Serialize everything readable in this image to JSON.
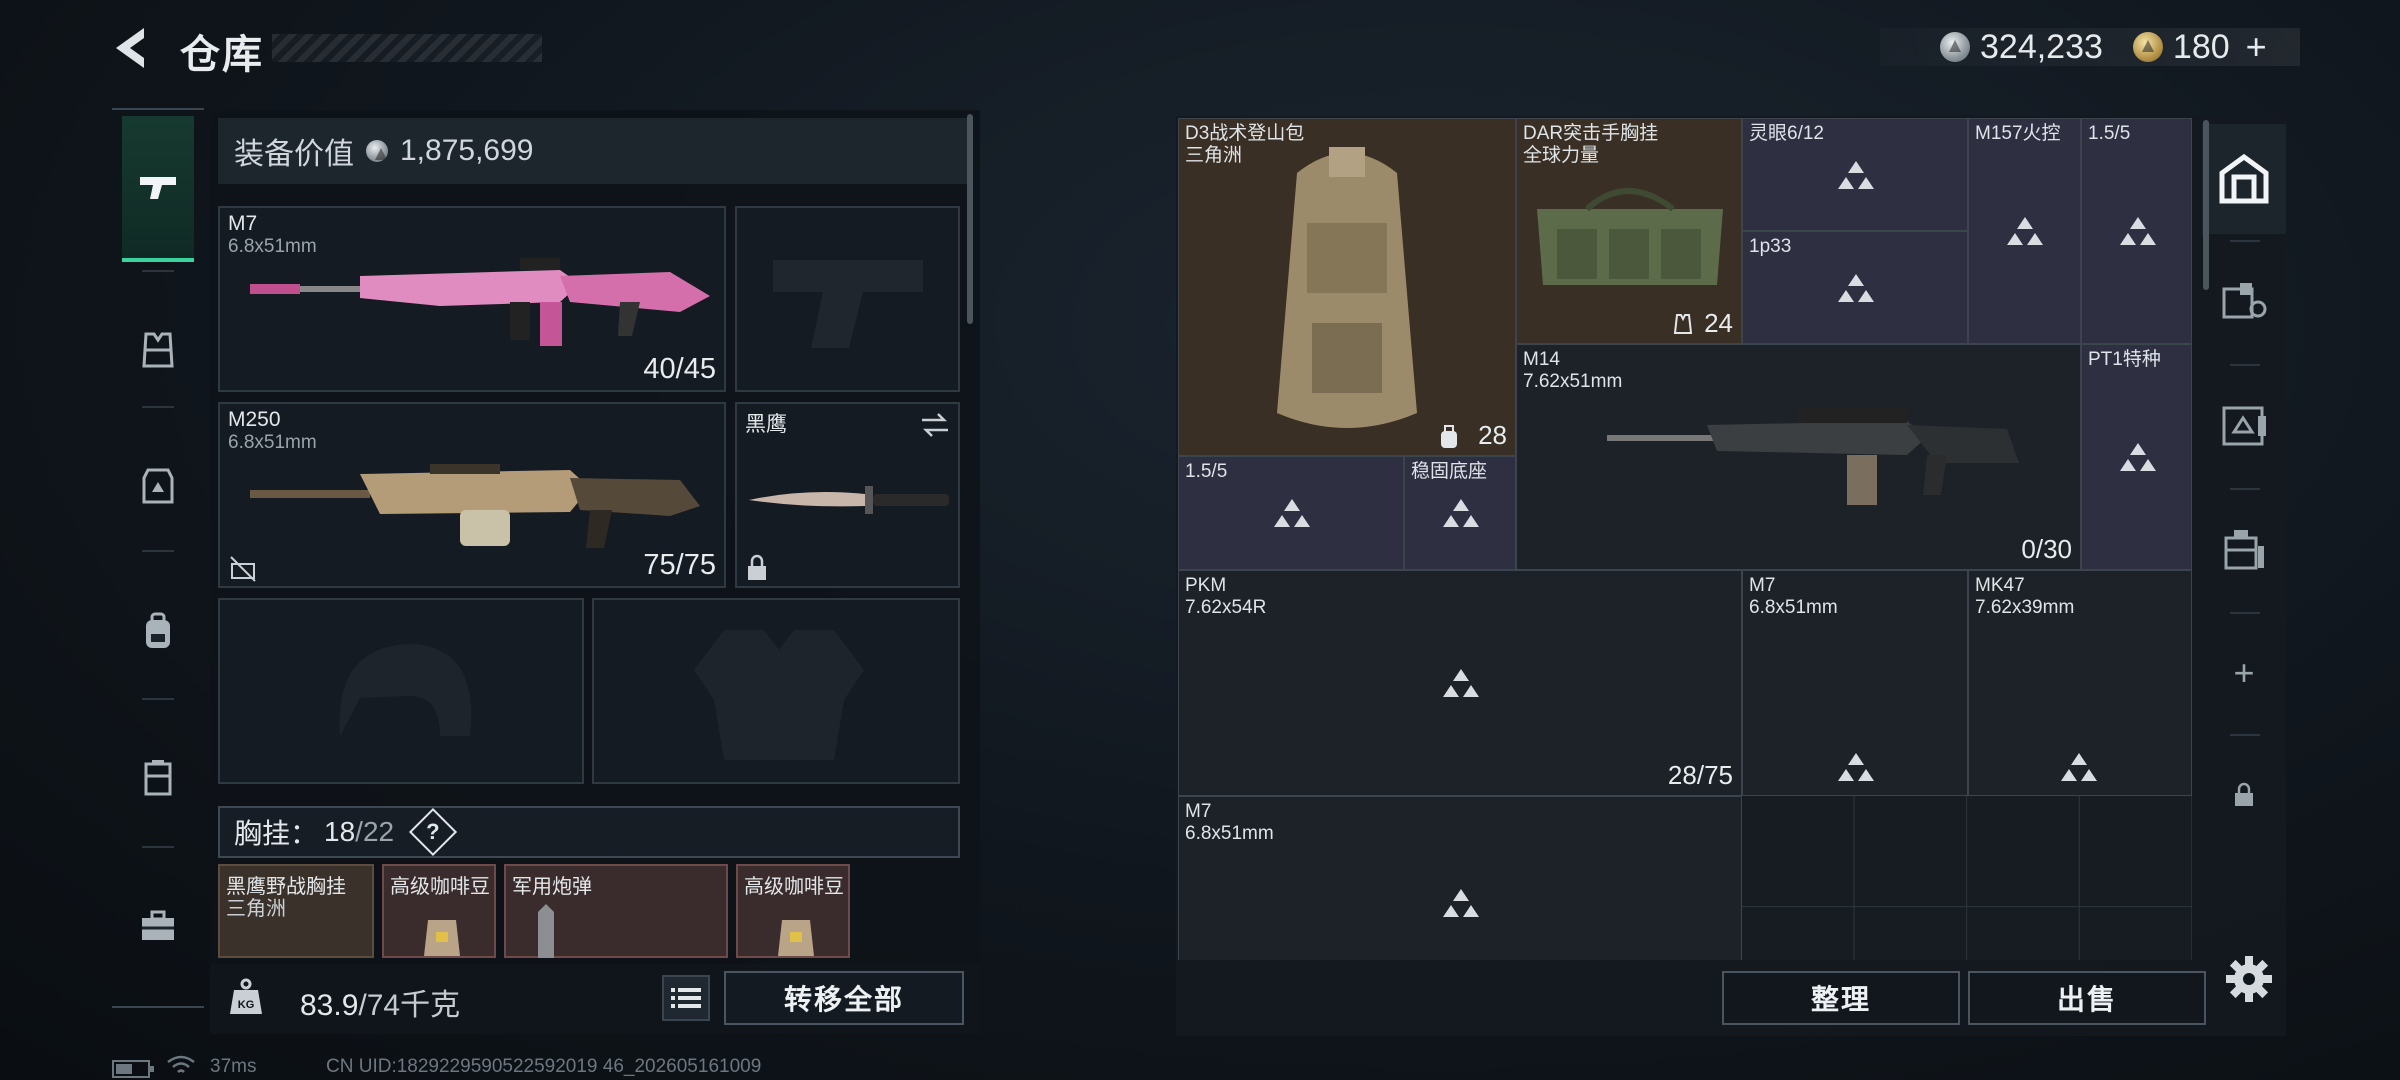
{
  "header": {
    "title": "仓库",
    "silver_value": "324,233",
    "gold_value": "180",
    "gold_plus": "+"
  },
  "equipment": {
    "value_label": "装备价值",
    "value": "1,875,699",
    "slots": [
      {
        "name": "M7",
        "sub": "6.8x51mm",
        "count": "40/45"
      },
      {
        "name": "M250",
        "sub": "6.8x51mm",
        "count": "75/75"
      },
      {
        "name": "黑鹰",
        "sub": "",
        "count": ""
      }
    ]
  },
  "vest": {
    "label": "胸挂：",
    "used": "18",
    "total": "/22",
    "help": "?",
    "items": [
      {
        "name": "黑鹰野战胸挂",
        "sub": "三角洲"
      },
      {
        "name": "高级咖啡豆"
      },
      {
        "name": "军用炮弹"
      },
      {
        "name": "高级咖啡豆"
      }
    ]
  },
  "footer_left": {
    "weight": "83.9",
    "weight_max": "/74千克",
    "transfer_label": "转移全部"
  },
  "status": {
    "ping": "37ms",
    "uid": "CN UID:1829229590522592019 46_202605161009"
  },
  "storage": {
    "items": [
      {
        "name": "D3战术登山包",
        "sub": "三角洲",
        "count": "28"
      },
      {
        "name": "DAR突击手胸挂",
        "sub": "全球力量",
        "count": "24"
      },
      {
        "name": "灵眼6/12"
      },
      {
        "name": "M157火控"
      },
      {
        "name": "1.5/5"
      },
      {
        "name": "1p33"
      },
      {
        "name": "M14",
        "sub": "7.62x51mm",
        "count": "0/30"
      },
      {
        "name": "PT1特种"
      },
      {
        "name": "1.5/5"
      },
      {
        "name": "稳固底座"
      },
      {
        "name": "PKM",
        "sub": "7.62x54R",
        "count": "28/75"
      },
      {
        "name": "M7",
        "sub": "6.8x51mm"
      },
      {
        "name": "MK47",
        "sub": "7.62x39mm"
      },
      {
        "name": "M7",
        "sub": "6.8x51mm"
      }
    ],
    "sort_label": "整理",
    "sell_label": "出售"
  },
  "right_sidebar": {
    "plus": "+"
  },
  "colors": {
    "accent_green": "#3ad39d",
    "purple_cell": "#2f2f42",
    "brown_cell": "#3a2f25"
  }
}
